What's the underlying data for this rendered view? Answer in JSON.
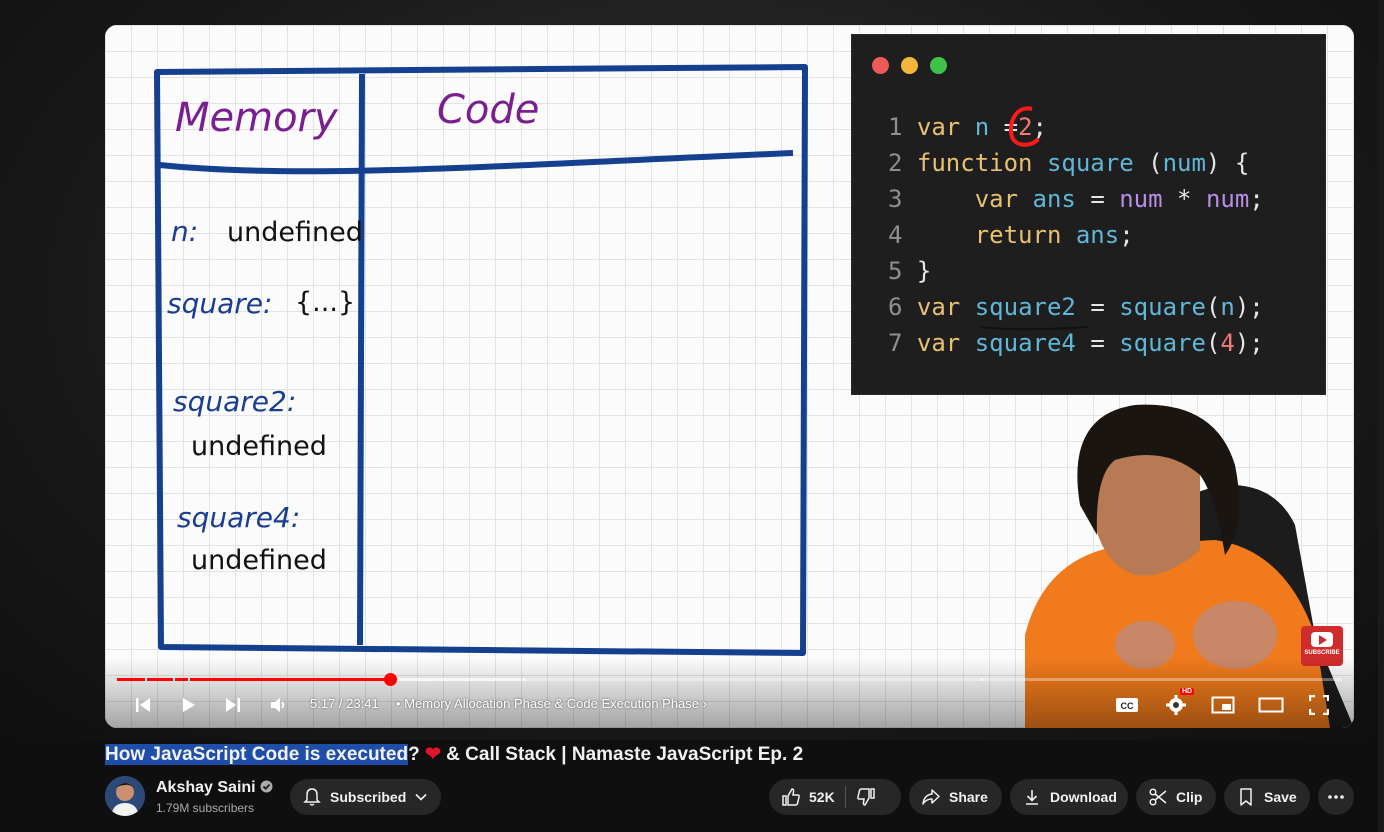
{
  "video": {
    "whiteboard": {
      "memory_heading": "Memory",
      "code_heading": "Code",
      "entries": [
        {
          "label": "n:",
          "value": "undefined"
        },
        {
          "label": "square:",
          "value": "{...}"
        },
        {
          "label": "square2:",
          "value": "undefined"
        },
        {
          "label": "square4:",
          "value": "undefined"
        }
      ]
    },
    "code": {
      "lines": [
        {
          "num": "1",
          "text": "var n = 2;"
        },
        {
          "num": "2",
          "text": "function square (num) {"
        },
        {
          "num": "3",
          "text": "    var ans = num * num;"
        },
        {
          "num": "4",
          "text": "    return ans;"
        },
        {
          "num": "5",
          "text": "}"
        },
        {
          "num": "6",
          "text": "var square2 = square(n);"
        },
        {
          "num": "7",
          "text": "var square4 = square(4);"
        }
      ]
    },
    "subscribe_badge": "SUBSCRIBE"
  },
  "player": {
    "current_time": "5:17",
    "duration": "23:41",
    "time_display": "5:17 / 23:41",
    "chapter_separator": "•",
    "chapter": "Memory Allocation Phase & Code Execution Phase",
    "progress_fraction": 0.223,
    "buffered_fraction": 0.33,
    "hd_badge": "HD",
    "icons": [
      "previous-icon",
      "play-icon",
      "next-icon",
      "volume-icon",
      "captions-icon",
      "settings-icon",
      "miniplayer-icon",
      "theater-icon",
      "fullscreen-icon"
    ]
  },
  "title": {
    "highlighted": "How JavaScript Code is executed",
    "rest_before_emoji": "?",
    "emoji": "❤️",
    "rest_after_emoji": "& Call Stack | Namaste JavaScript Ep. 2"
  },
  "channel": {
    "name": "Akshay Saini",
    "subscribers": "1.79M subscribers",
    "subscribed_label": "Subscribed"
  },
  "actions": {
    "likes": "52K",
    "share": "Share",
    "download": "Download",
    "clip": "Clip",
    "save": "Save"
  },
  "colors": {
    "accent_red": "#ff0000",
    "title_highlight": "#1f4ea8",
    "pill_bg": "#272727",
    "page_bg": "#0f0f0f"
  }
}
